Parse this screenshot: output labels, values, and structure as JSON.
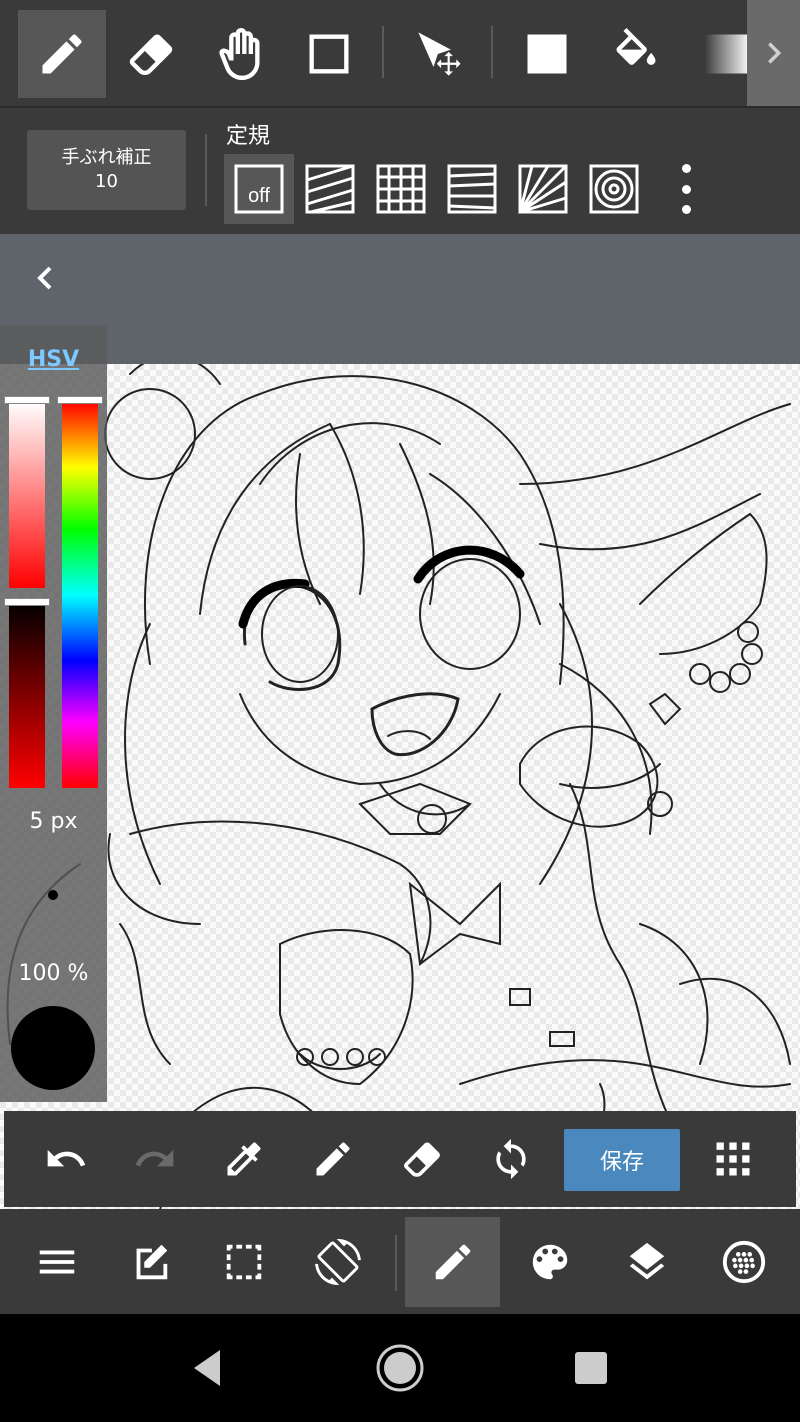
{
  "toolbar": {
    "tools": [
      {
        "name": "pen-tool",
        "icon": "pencil-icon",
        "active": true
      },
      {
        "name": "eraser-tool",
        "icon": "eraser-icon"
      },
      {
        "name": "hand-tool",
        "icon": "hand-icon"
      },
      {
        "name": "rectangle-tool",
        "icon": "square-outline-icon"
      },
      {
        "name": "move-tool",
        "icon": "move-icon"
      },
      {
        "name": "fill-rect-tool",
        "icon": "filled-square-icon"
      },
      {
        "name": "bucket-tool",
        "icon": "paint-bucket-icon"
      },
      {
        "name": "gradient-tool",
        "icon": "gradient-icon"
      }
    ],
    "more_icon": "chevron-right-icon"
  },
  "stabilizer": {
    "label": "手ぶれ補正",
    "value": "10"
  },
  "ruler": {
    "label": "定規",
    "off_text": "off",
    "options": [
      "off",
      "parallel",
      "grid",
      "perspective-lines",
      "radial",
      "concentric"
    ],
    "selected": "off"
  },
  "color_panel": {
    "mode_label": "HSV",
    "brush_size": "5 px",
    "opacity": "100 %",
    "current_color": "#000000",
    "hue_color": "#ff0000"
  },
  "actions": {
    "undo_icon": "undo-icon",
    "redo_icon": "redo-icon",
    "eyedropper_icon": "eyedropper-icon",
    "pen_icon": "pencil-icon",
    "eraser_icon": "eraser-icon",
    "rotate_icon": "refresh-icon",
    "save_label": "保存",
    "grid_icon": "dots-grid-icon"
  },
  "nav": {
    "items": [
      "menu-icon",
      "edit-icon",
      "selection-icon",
      "rotate-screen-icon",
      "brush-icon",
      "palette-icon",
      "layers-icon",
      "material-icon"
    ],
    "active": "brush-icon"
  },
  "colors": {
    "toolbar_bg": "#3a3a3a",
    "active_bg": "#575757",
    "accent": "#4b88bd",
    "hsv_link": "#7cc8ff"
  }
}
